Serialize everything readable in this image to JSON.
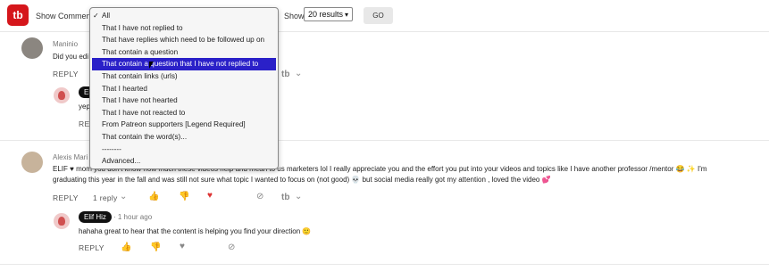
{
  "toolbar": {
    "logo": "tb",
    "show_comment_label": "Show Comment",
    "show_label": "Show",
    "results_select": "20 results",
    "go_label": "GO"
  },
  "dropdown": {
    "options": [
      "All",
      "That I have not replied to",
      "That have replies which need to be followed up on",
      "That contain a question",
      "That contain a question that I have not replied to",
      "That contain links (urls)",
      "That I hearted",
      "That I have not hearted",
      "That I have not reacted to",
      "From Patreon supporters [Legend Required]",
      "That contain the word(s)...",
      "--------",
      "Advanced..."
    ],
    "selected_index": 0,
    "highlighted_index": 4
  },
  "comments": [
    {
      "author": "Maninio",
      "text": "Did you edi",
      "reply_label": "REPLY",
      "reply": {
        "author_badge": "Eli",
        "text": "yep",
        "reply_label": "REP"
      }
    },
    {
      "author": "Alexis Mari",
      "text_line1": "ELIF ♥ mom you don't know how much these videos help and mean to us marketers lol I really appreciate you and the effort you put into your videos and topics like I have another professor /mentor 😂 ✨ I'm",
      "text_line2": "graduating this year in the fall and was still not sure what topic I wanted to focus on (not good) 💀 but social media really got my attention , loved the video 💕",
      "reply_label": "REPLY",
      "replies_count": "1 reply",
      "reply": {
        "author_badge": "Elif Hiz",
        "time": "· 1 hour ago",
        "text": "hahaha great to hear that the content is helping you find your direction 🙂",
        "reply_label": "REPLY"
      }
    }
  ],
  "icons": {
    "thumbs_up": "👍",
    "thumbs_down": "👎",
    "heart": "♥",
    "hide": "◍",
    "tb": "tb",
    "chevron": "⌄"
  }
}
